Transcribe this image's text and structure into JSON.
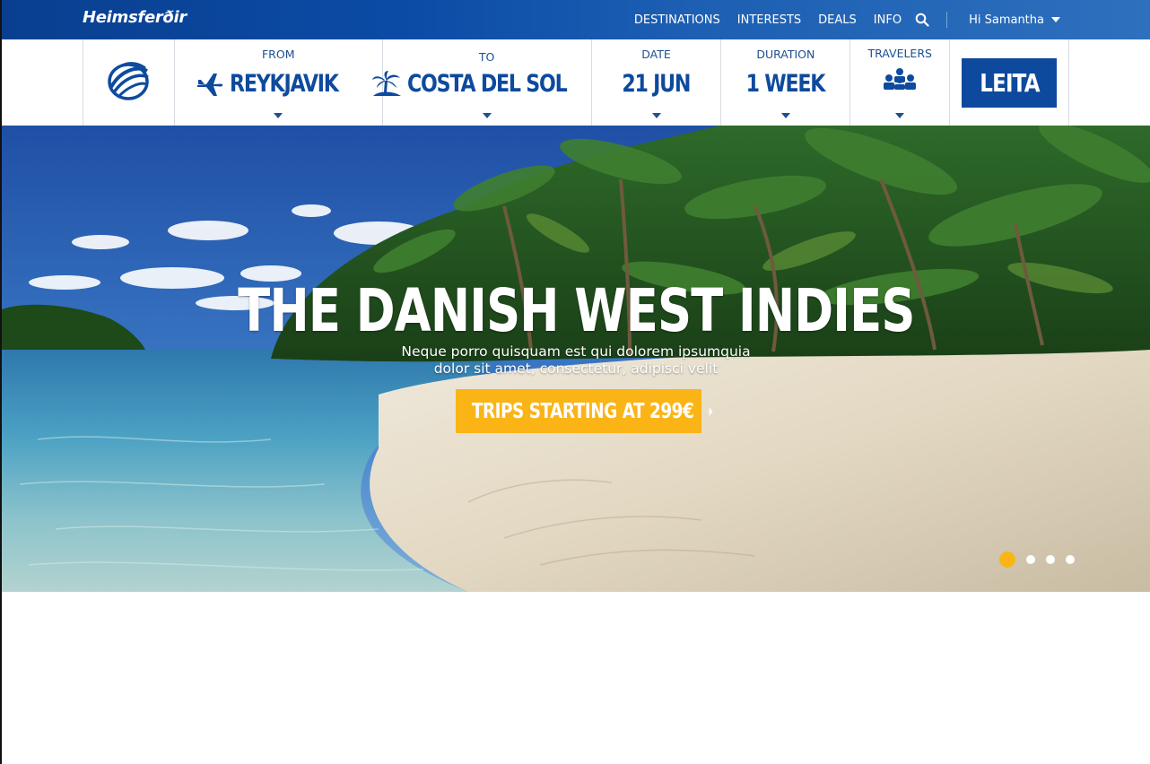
{
  "brand": {
    "name": "Heimsferðir"
  },
  "nav": {
    "links": [
      "DESTINATIONS",
      "INTERESTS",
      "DEALS",
      "INFO"
    ],
    "search_icon": "search-icon",
    "user_greeting": "Hi Samantha"
  },
  "search": {
    "logo_icon": "globe-swoosh-icon",
    "from": {
      "label": "FROM",
      "value": "REYKJAVIK",
      "icon": "airplane-icon"
    },
    "to": {
      "label": "TO",
      "value": "COSTA DEL SOL",
      "icon": "palm-island-icon"
    },
    "date": {
      "label": "DATE",
      "value": "21 JUN"
    },
    "duration": {
      "label": "DURATION",
      "value": "1 WEEK"
    },
    "travelers": {
      "label": "TRAVELERS",
      "icon": "people-group-icon"
    },
    "button_label": "LEITA"
  },
  "hero": {
    "title": "THE DANISH WEST INDIES",
    "subtitle_line1": "Neque porro quisquam est qui dolorem ipsumquia",
    "subtitle_line2": "dolor sit amet, consectetur, adipisci velit",
    "cta_label": "TRIPS STARTING AT 299€",
    "slide_count": 4,
    "active_slide": 1
  },
  "colors": {
    "brand_blue": "#0d4a9e",
    "accent_yellow": "#fbb416",
    "label_blue": "#1d4f91"
  }
}
